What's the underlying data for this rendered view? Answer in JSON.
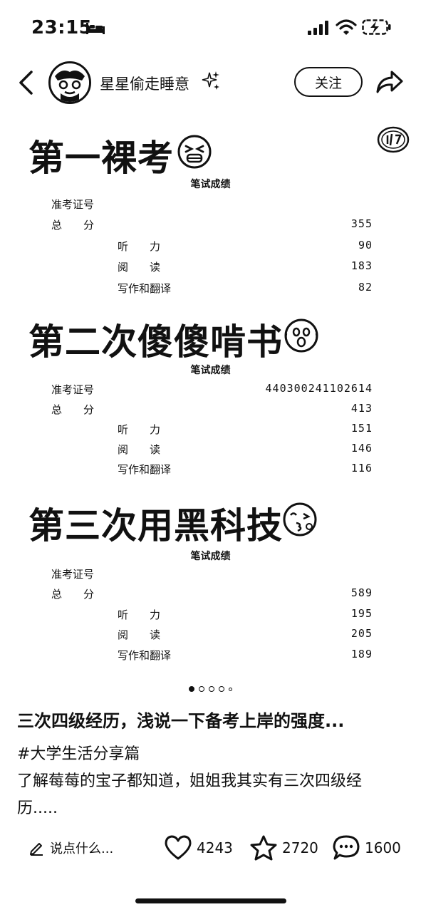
{
  "status_bar": {
    "time": "23:15"
  },
  "header": {
    "username": "星星偷走睡意",
    "follow_label": "关注"
  },
  "post_image": {
    "sections": [
      {
        "heading": "第一裸考",
        "table_title": "笔试成绩",
        "rows": [
          {
            "label": "准考证号",
            "value": ""
          },
          {
            "label": "总　　分",
            "value": "355"
          },
          {
            "label": "听　　力",
            "value": "90"
          },
          {
            "label": "阅　　读",
            "value": "183"
          },
          {
            "label": "写作和翻译",
            "value": "82"
          }
        ]
      },
      {
        "heading": "第二次傻傻啃书",
        "table_title": "笔试成绩",
        "rows": [
          {
            "label": "准考证号",
            "value": "440300241102614"
          },
          {
            "label": "总　　分",
            "value": "413"
          },
          {
            "label": "听　　力",
            "value": "151"
          },
          {
            "label": "阅　　读",
            "value": "146"
          },
          {
            "label": "写作和翻译",
            "value": "116"
          }
        ]
      },
      {
        "heading": "第三次用黑科技",
        "table_title": "笔试成绩",
        "rows": [
          {
            "label": "准考证号",
            "value": ""
          },
          {
            "label": "总　　分",
            "value": "589"
          },
          {
            "label": "听　　力",
            "value": "195"
          },
          {
            "label": "阅　　读",
            "value": "205"
          },
          {
            "label": "写作和翻译",
            "value": "189"
          }
        ]
      }
    ],
    "pagination": {
      "current": 1,
      "total": 5
    }
  },
  "post": {
    "title": "三次四级经历，浅说一下备考上岸的强度...",
    "hashtag": "#大学生活分享篇",
    "body": "了解莓莓的宝子都知道，姐姐我其实有三次四级经历....."
  },
  "bottom_bar": {
    "comment_placeholder": "说点什么...",
    "likes": "4243",
    "favorites": "2720",
    "comments": "1600"
  }
}
